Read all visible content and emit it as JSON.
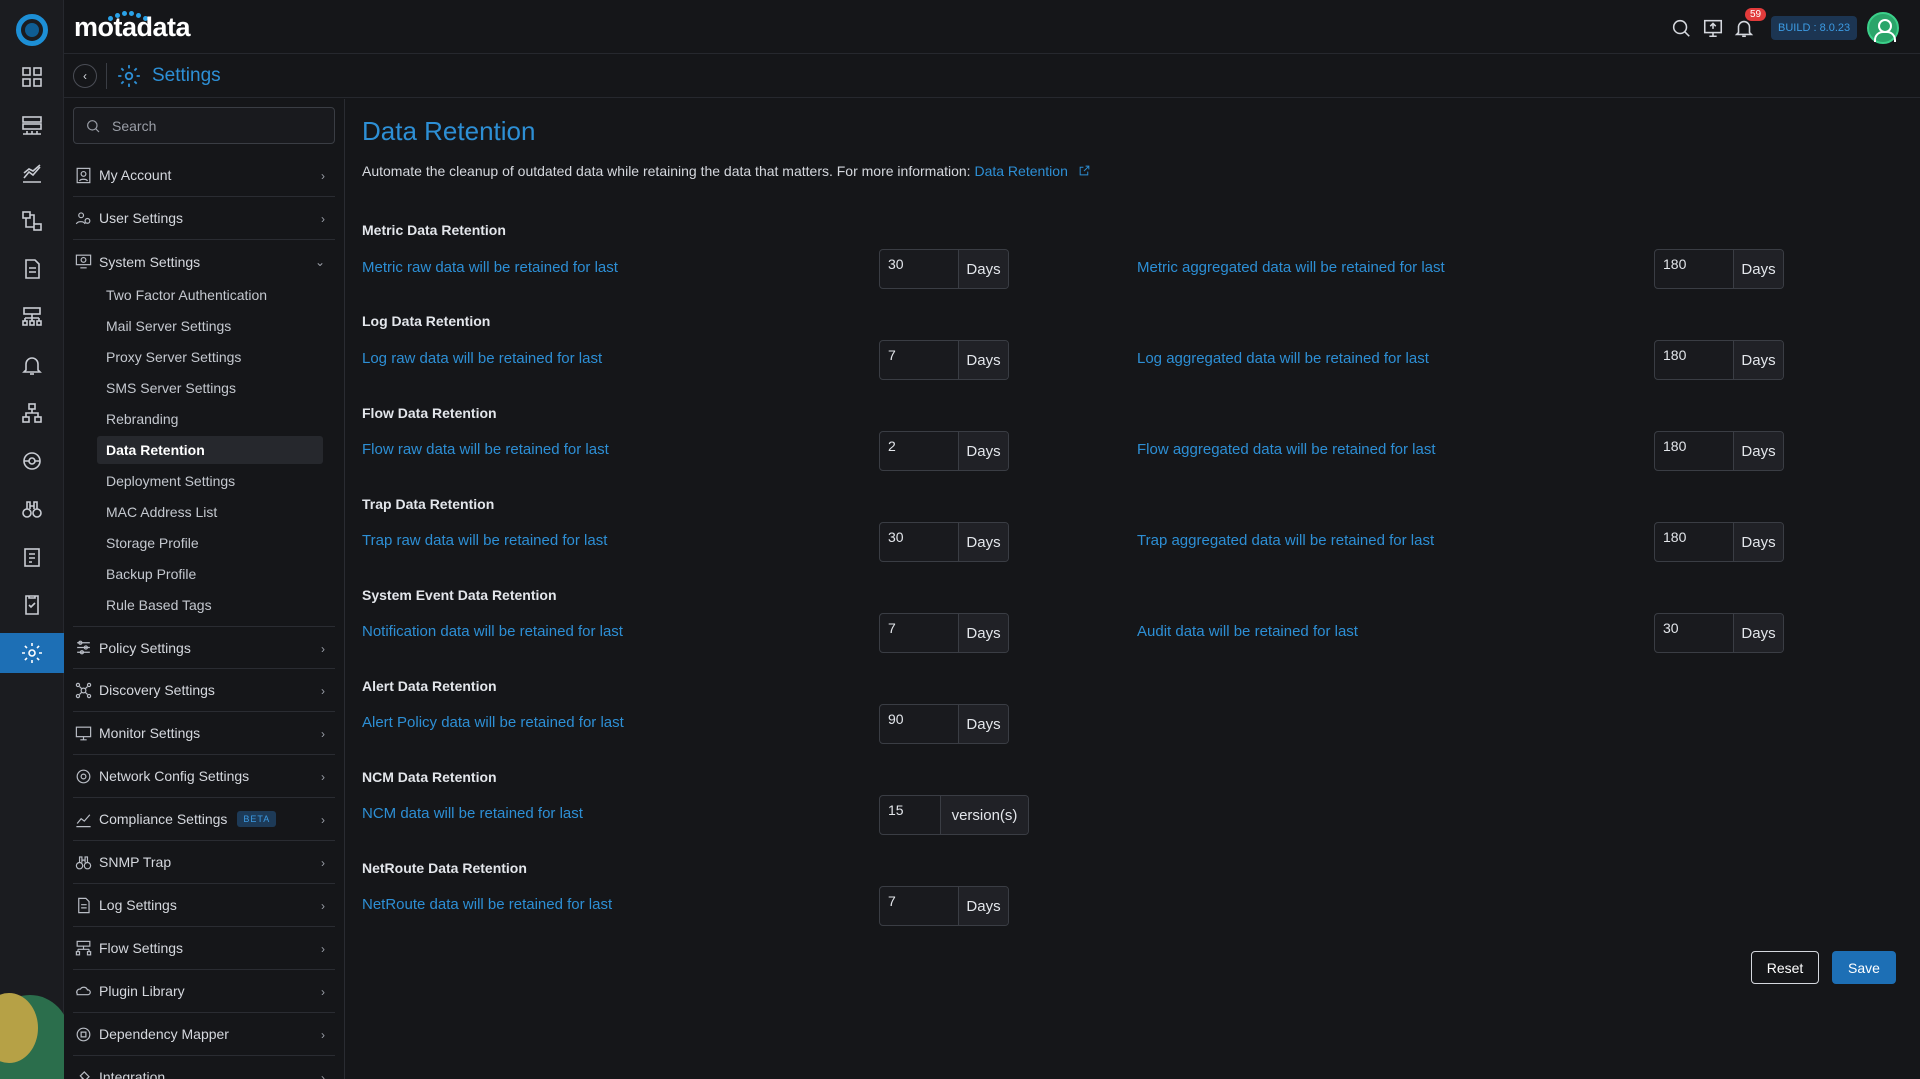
{
  "app": {
    "brand": "motadata",
    "build": "BUILD : 8.0.23",
    "notifications": "59"
  },
  "header": {
    "title": "Settings"
  },
  "sidebar": {
    "search_placeholder": "Search",
    "items": [
      {
        "label": "My Account",
        "icon": "user-icon"
      },
      {
        "label": "User Settings",
        "icon": "users-cog-icon"
      },
      {
        "label": "System Settings",
        "icon": "system-cog-icon",
        "expanded": true
      },
      {
        "label": "Policy Settings",
        "icon": "sliders-icon"
      },
      {
        "label": "Discovery Settings",
        "icon": "discovery-icon"
      },
      {
        "label": "Monitor Settings",
        "icon": "monitor-icon"
      },
      {
        "label": "Network Config Settings",
        "icon": "network-config-icon"
      },
      {
        "label": "Compliance Settings",
        "icon": "compliance-icon",
        "badge": "BETA"
      },
      {
        "label": "SNMP Trap",
        "icon": "binoculars-icon"
      },
      {
        "label": "Log Settings",
        "icon": "document-icon"
      },
      {
        "label": "Flow Settings",
        "icon": "flow-icon"
      },
      {
        "label": "Plugin Library",
        "icon": "plugin-icon"
      },
      {
        "label": "Dependency Mapper",
        "icon": "dependency-icon"
      },
      {
        "label": "Integration",
        "icon": "integration-icon"
      }
    ],
    "system_sub_items": [
      "Two Factor Authentication",
      "Mail Server Settings",
      "Proxy Server Settings",
      "SMS Server Settings",
      "Rebranding",
      "Data Retention",
      "Deployment Settings",
      "MAC Address List",
      "Storage Profile",
      "Backup Profile",
      "Rule Based Tags"
    ],
    "active_sub_item": "Data Retention"
  },
  "page": {
    "title": "Data Retention",
    "description": "Automate the cleanup of outdated data while retaining the data that matters. For more information:",
    "link_text": "Data Retention"
  },
  "sections": [
    {
      "heading": "Metric Data Retention",
      "left": {
        "label": "Metric raw data will be retained for last",
        "value": "30",
        "unit": "Days"
      },
      "right": {
        "label": "Metric aggregated data will be retained for last",
        "value": "180",
        "unit": "Days"
      }
    },
    {
      "heading": "Log Data Retention",
      "left": {
        "label": "Log raw data will be retained for last",
        "value": "7",
        "unit": "Days"
      },
      "right": {
        "label": "Log aggregated data will be retained for last",
        "value": "180",
        "unit": "Days"
      }
    },
    {
      "heading": "Flow Data Retention",
      "left": {
        "label": "Flow raw data will be retained for last",
        "value": "2",
        "unit": "Days"
      },
      "right": {
        "label": "Flow aggregated data will be retained for last",
        "value": "180",
        "unit": "Days"
      }
    },
    {
      "heading": "Trap Data Retention",
      "left": {
        "label": "Trap raw data will be retained for last",
        "value": "30",
        "unit": "Days"
      },
      "right": {
        "label": "Trap aggregated data will be retained for last",
        "value": "180",
        "unit": "Days"
      }
    },
    {
      "heading": "System Event Data Retention",
      "left": {
        "label": "Notification data will be retained for last",
        "value": "7",
        "unit": "Days"
      },
      "right": {
        "label": "Audit data will be retained for last",
        "value": "30",
        "unit": "Days"
      }
    },
    {
      "heading": "Alert Data Retention",
      "left": {
        "label": "Alert Policy data will be retained for last",
        "value": "90",
        "unit": "Days"
      }
    },
    {
      "heading": "NCM Data Retention",
      "left": {
        "label": "NCM data will be retained for last",
        "value": "15",
        "unit": "version(s)"
      }
    },
    {
      "heading": "NetRoute Data Retention",
      "left": {
        "label": "NetRoute data will be retained for last",
        "value": "7",
        "unit": "Days"
      }
    }
  ],
  "actions": {
    "reset": "Reset",
    "save": "Save"
  },
  "colors": {
    "accent": "#2d8fd5",
    "primary_button": "#1d6fb5",
    "background": "#151619",
    "notification_badge": "#e23b3b"
  }
}
